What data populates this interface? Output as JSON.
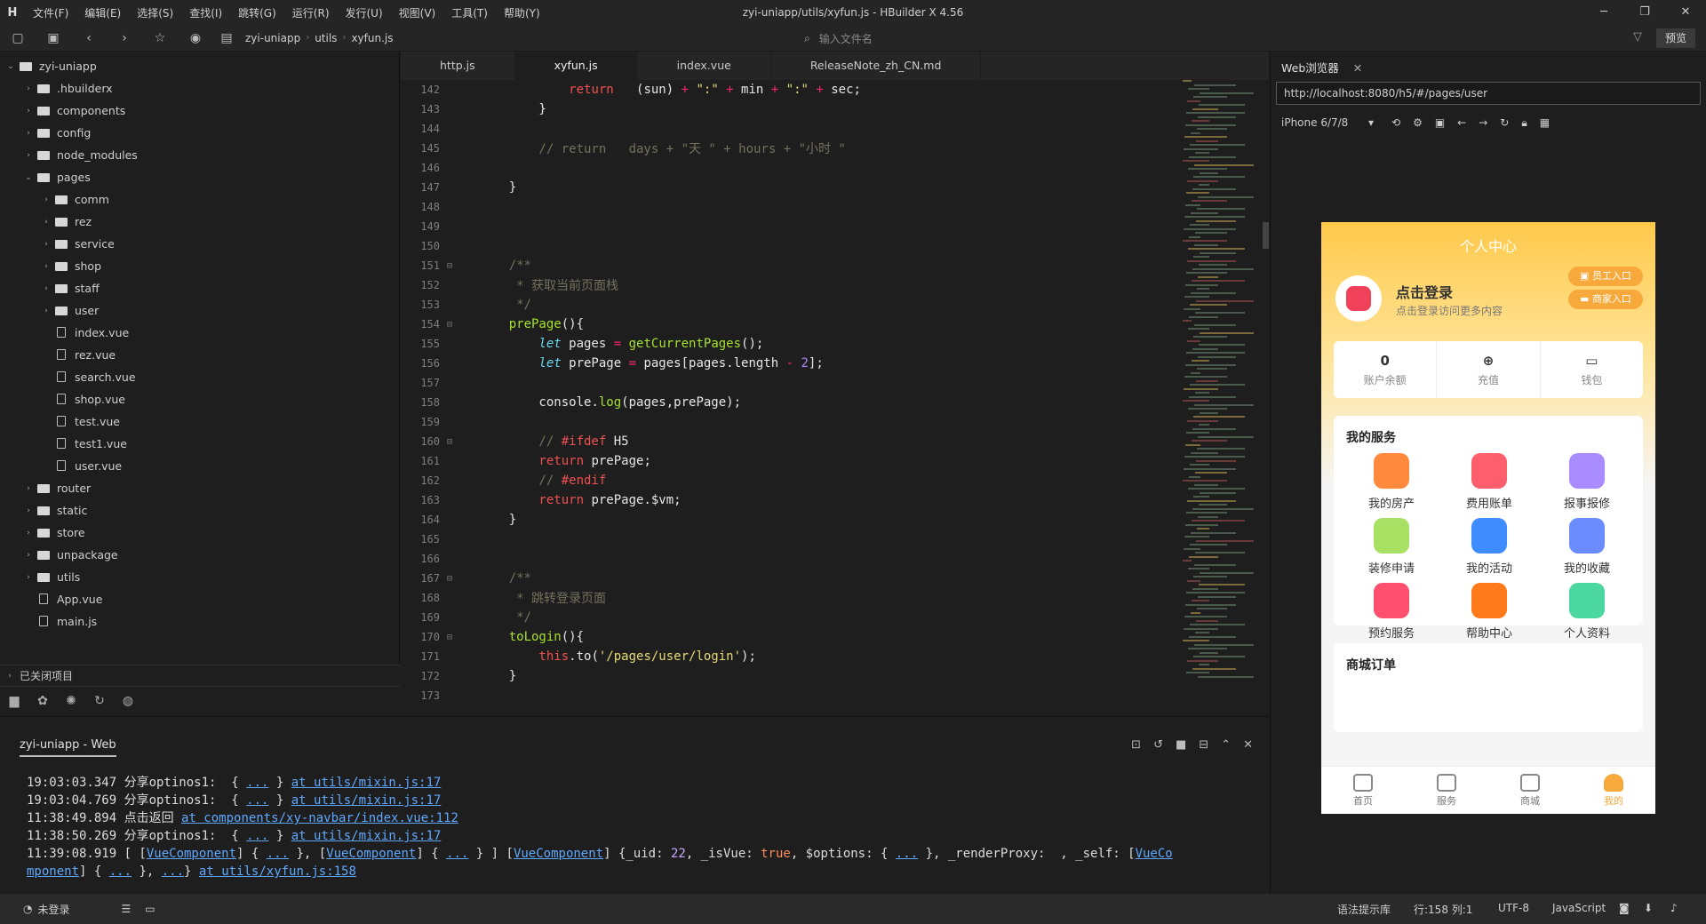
{
  "titlebar": {
    "title": "zyi-uniapp/utils/xyfun.js - HBuilder X 4.56",
    "menus": [
      "文件(F)",
      "编辑(E)",
      "选择(S)",
      "查找(I)",
      "跳转(G)",
      "运行(R)",
      "发行(U)",
      "视图(V)",
      "工具(T)",
      "帮助(Y)"
    ]
  },
  "toolbar": {
    "breadcrumbs": [
      "zyi-uniapp",
      "utils",
      "xyfun.js"
    ],
    "file_search_placeholder": "输入文件名",
    "preview_label": "预览"
  },
  "sidebar": {
    "tree": [
      {
        "label": "zyi-uniapp",
        "depth": 0,
        "type": "root",
        "expanded": true
      },
      {
        "label": ".hbuilderx",
        "depth": 1,
        "type": "folder"
      },
      {
        "label": "components",
        "depth": 1,
        "type": "folder"
      },
      {
        "label": "config",
        "depth": 1,
        "type": "folder"
      },
      {
        "label": "node_modules",
        "depth": 1,
        "type": "folder"
      },
      {
        "label": "pages",
        "depth": 1,
        "type": "folder",
        "expanded": true
      },
      {
        "label": "comm",
        "depth": 2,
        "type": "folder"
      },
      {
        "label": "rez",
        "depth": 2,
        "type": "folder"
      },
      {
        "label": "service",
        "depth": 2,
        "type": "folder"
      },
      {
        "label": "shop",
        "depth": 2,
        "type": "folder"
      },
      {
        "label": "staff",
        "depth": 2,
        "type": "folder"
      },
      {
        "label": "user",
        "depth": 2,
        "type": "folder"
      },
      {
        "label": "index.vue",
        "depth": 2,
        "type": "file"
      },
      {
        "label": "rez.vue",
        "depth": 2,
        "type": "file"
      },
      {
        "label": "search.vue",
        "depth": 2,
        "type": "file"
      },
      {
        "label": "shop.vue",
        "depth": 2,
        "type": "file"
      },
      {
        "label": "test.vue",
        "depth": 2,
        "type": "file"
      },
      {
        "label": "test1.vue",
        "depth": 2,
        "type": "file"
      },
      {
        "label": "user.vue",
        "depth": 2,
        "type": "file"
      },
      {
        "label": "router",
        "depth": 1,
        "type": "folder"
      },
      {
        "label": "static",
        "depth": 1,
        "type": "folder"
      },
      {
        "label": "store",
        "depth": 1,
        "type": "folder"
      },
      {
        "label": "unpackage",
        "depth": 1,
        "type": "folder"
      },
      {
        "label": "utils",
        "depth": 1,
        "type": "folder"
      },
      {
        "label": "App.vue",
        "depth": 1,
        "type": "file"
      },
      {
        "label": "main.js",
        "depth": 1,
        "type": "file"
      }
    ],
    "closed_projects": "已关闭项目"
  },
  "editor": {
    "tabs": [
      "http.js",
      "xyfun.js",
      "index.vue",
      "ReleaseNote_zh_CN.md"
    ],
    "active_tab": "xyfun.js",
    "lines": [
      {
        "n": "142",
        "fold": false,
        "segs": [
          [
            "",
            "            "
          ],
          [
            "kw",
            "return"
          ],
          [
            "",
            "   (sun) "
          ],
          [
            "op",
            "+"
          ],
          [
            "str",
            " \":\" "
          ],
          [
            "op",
            "+"
          ],
          [
            "",
            " min "
          ],
          [
            "op",
            "+"
          ],
          [
            "str",
            " \":\" "
          ],
          [
            "op",
            "+"
          ],
          [
            "",
            " sec;"
          ]
        ]
      },
      {
        "n": "143",
        "fold": false,
        "segs": [
          [
            "",
            "        }"
          ]
        ]
      },
      {
        "n": "144",
        "fold": false,
        "segs": []
      },
      {
        "n": "145",
        "fold": false,
        "segs": [
          [
            "cm",
            "        // return   days + \"天 \" + hours + \"小时 \""
          ]
        ]
      },
      {
        "n": "146",
        "fold": false,
        "segs": []
      },
      {
        "n": "147",
        "fold": false,
        "segs": [
          [
            "",
            "    }"
          ]
        ]
      },
      {
        "n": "148",
        "fold": false,
        "segs": []
      },
      {
        "n": "149",
        "fold": false,
        "segs": []
      },
      {
        "n": "150",
        "fold": false,
        "segs": []
      },
      {
        "n": "151",
        "fold": true,
        "segs": [
          [
            "cm",
            "    /**"
          ]
        ]
      },
      {
        "n": "152",
        "fold": false,
        "segs": [
          [
            "cm",
            "     * 获取当前页面栈"
          ]
        ]
      },
      {
        "n": "153",
        "fold": false,
        "segs": [
          [
            "cm",
            "     */"
          ]
        ]
      },
      {
        "n": "154",
        "fold": true,
        "segs": [
          [
            "fn",
            "    prePage"
          ],
          [
            "",
            "(){"
          ]
        ]
      },
      {
        "n": "155",
        "fold": false,
        "segs": [
          [
            "it",
            "        let"
          ],
          [
            "",
            " pages "
          ],
          [
            "op",
            "="
          ],
          [
            "fn",
            " getCurrentPages"
          ],
          [
            "",
            "();"
          ]
        ]
      },
      {
        "n": "156",
        "fold": false,
        "segs": [
          [
            "it",
            "        let"
          ],
          [
            "",
            " prePage "
          ],
          [
            "op",
            "="
          ],
          [
            "",
            " pages[pages.length "
          ],
          [
            "op",
            "-"
          ],
          [
            "num",
            " 2"
          ],
          [
            "",
            "];"
          ]
        ]
      },
      {
        "n": "157",
        "fold": false,
        "segs": []
      },
      {
        "n": "158",
        "fold": false,
        "segs": [
          [
            "",
            "        console."
          ],
          [
            "fn",
            "log"
          ],
          [
            "",
            "(pages,prePage);"
          ]
        ]
      },
      {
        "n": "159",
        "fold": false,
        "segs": []
      },
      {
        "n": "160",
        "fold": true,
        "segs": [
          [
            "cm",
            "        // "
          ],
          [
            "kw",
            "#ifdef"
          ],
          [
            "",
            " H5"
          ]
        ]
      },
      {
        "n": "161",
        "fold": false,
        "segs": [
          [
            "kw",
            "        return"
          ],
          [
            "",
            " prePage;"
          ]
        ]
      },
      {
        "n": "162",
        "fold": false,
        "segs": [
          [
            "cm",
            "        // "
          ],
          [
            "kw",
            "#endif"
          ]
        ]
      },
      {
        "n": "163",
        "fold": false,
        "segs": [
          [
            "kw",
            "        return"
          ],
          [
            "",
            " prePage.$vm;"
          ]
        ]
      },
      {
        "n": "164",
        "fold": false,
        "segs": [
          [
            "",
            "    }"
          ]
        ]
      },
      {
        "n": "165",
        "fold": false,
        "segs": []
      },
      {
        "n": "166",
        "fold": false,
        "segs": []
      },
      {
        "n": "167",
        "fold": true,
        "segs": [
          [
            "cm",
            "    /**"
          ]
        ]
      },
      {
        "n": "168",
        "fold": false,
        "segs": [
          [
            "cm",
            "     * 跳转登录页面"
          ]
        ]
      },
      {
        "n": "169",
        "fold": false,
        "segs": [
          [
            "cm",
            "     */"
          ]
        ]
      },
      {
        "n": "170",
        "fold": true,
        "segs": [
          [
            "fn",
            "    toLogin"
          ],
          [
            "",
            "(){"
          ]
        ]
      },
      {
        "n": "171",
        "fold": false,
        "segs": [
          [
            "kw",
            "        this"
          ],
          [
            "",
            ".to("
          ],
          [
            "str",
            "'/pages/user/login'"
          ],
          [
            "",
            ");"
          ]
        ]
      },
      {
        "n": "172",
        "fold": false,
        "segs": [
          [
            "",
            "    }"
          ]
        ]
      },
      {
        "n": "173",
        "fold": false,
        "segs": []
      }
    ]
  },
  "console": {
    "title": "zyi-uniapp - Web",
    "lines": [
      [
        [
          "",
          "19:03:03.347 分享optinos1:  { "
        ],
        [
          "lnk",
          "..."
        ],
        [
          "",
          " } "
        ],
        [
          "lnk",
          "at utils/mixin.js:17"
        ]
      ],
      [
        [
          "",
          "19:03:04.769 分享optinos1:  { "
        ],
        [
          "lnk",
          "..."
        ],
        [
          "",
          " } "
        ],
        [
          "lnk",
          "at utils/mixin.js:17"
        ]
      ],
      [
        [
          "",
          "11:38:49.894 点击返回 "
        ],
        [
          "lnk",
          "at components/xy-navbar/index.vue:112"
        ]
      ],
      [
        [
          "",
          "11:38:50.269 分享optinos1:  { "
        ],
        [
          "lnk",
          "..."
        ],
        [
          "",
          " } "
        ],
        [
          "lnk",
          "at utils/mixin.js:17"
        ]
      ],
      [
        [
          "",
          "11:39:08.919 [ ["
        ],
        [
          "lnk",
          "VueComponent"
        ],
        [
          "",
          "] { "
        ],
        [
          "lnk",
          "..."
        ],
        [
          "",
          " }, ["
        ],
        [
          "lnk",
          "VueComponent"
        ],
        [
          "",
          "] { "
        ],
        [
          "lnk",
          "..."
        ],
        [
          "",
          " } ] ["
        ],
        [
          "lnk",
          "VueComponent"
        ],
        [
          "",
          "] {_uid: "
        ],
        [
          "n22",
          "22"
        ],
        [
          "",
          ", _isVue: "
        ],
        [
          "bool",
          "true"
        ],
        [
          "",
          ", $options: { "
        ],
        [
          "lnk",
          "..."
        ],
        [
          "",
          " }, _renderProxy:  , _self: ["
        ],
        [
          "lnk",
          "VueCo"
        ]
      ],
      [
        [
          "lnk",
          "mponent"
        ],
        [
          "",
          "] { "
        ],
        [
          "lnk",
          "..."
        ],
        [
          "",
          " }, "
        ],
        [
          "lnk",
          "..."
        ],
        [
          "",
          "} "
        ],
        [
          "lnk",
          "at utils/xyfun.js:158"
        ]
      ]
    ]
  },
  "statusbar": {
    "login": "未登录",
    "syntax_lib": "语法提示库",
    "cursor": "行:158  列:1",
    "encoding": "UTF-8",
    "language": "JavaScript"
  },
  "browser": {
    "tab_label": "Web浏览器",
    "url": "http://localhost:8080/h5/#/pages/user",
    "device": "iPhone 6/7/8"
  },
  "phone": {
    "page_title": "个人中心",
    "login_title": "点击登录",
    "login_sub": "点击登录访问更多内容",
    "staff_entry": "员工入口",
    "merchant_entry": "商家入口",
    "balance_value": "0",
    "balance_label": "账户余额",
    "recharge_label": "充值",
    "wallet_label": "钱包",
    "services_title": "我的服务",
    "services": [
      {
        "label": "我的房产",
        "color": "#ff8a3d"
      },
      {
        "label": "费用账单",
        "color": "#ff5f6d"
      },
      {
        "label": "报事报修",
        "color": "#a88cff"
      },
      {
        "label": "装修申请",
        "color": "#a8e063"
      },
      {
        "label": "我的活动",
        "color": "#3f8cff"
      },
      {
        "label": "我的收藏",
        "color": "#6a8cff"
      },
      {
        "label": "预约服务",
        "color": "#ff4f6e"
      },
      {
        "label": "帮助中心",
        "color": "#ff7a1a"
      },
      {
        "label": "个人资料",
        "color": "#4cd6a0"
      }
    ],
    "orders_title": "商城订单",
    "tabbar": [
      {
        "label": "首页",
        "active": false
      },
      {
        "label": "服务",
        "active": false
      },
      {
        "label": "商城",
        "active": false
      },
      {
        "label": "我的",
        "active": true
      }
    ]
  }
}
